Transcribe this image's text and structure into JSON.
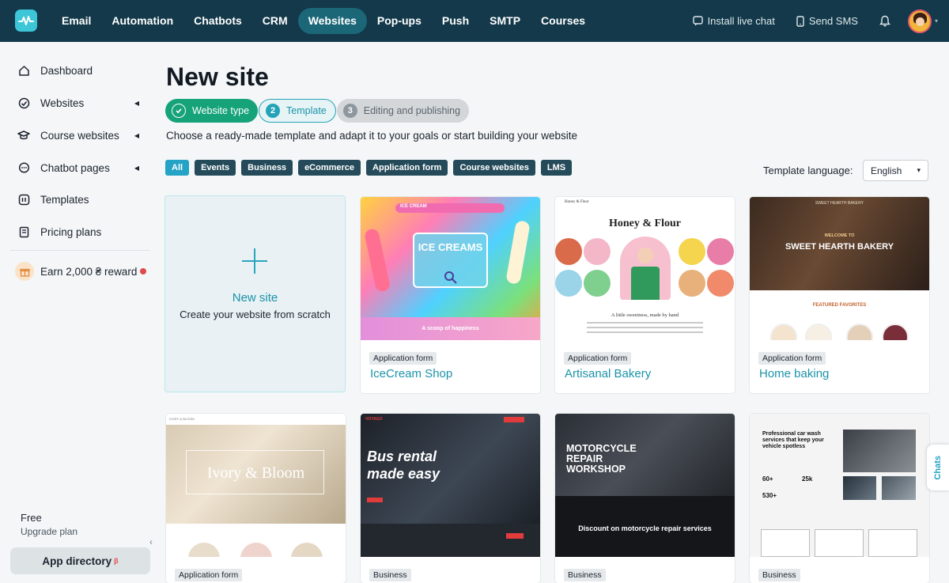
{
  "topbar": {
    "nav": [
      "Email",
      "Automation",
      "Chatbots",
      "CRM",
      "Websites",
      "Pop-ups",
      "Push",
      "SMTP",
      "Courses"
    ],
    "active_nav": "Websites",
    "install_live_chat": "Install live chat",
    "send_sms": "Send SMS",
    "accent": "#13394a"
  },
  "sidebar": {
    "items": [
      {
        "label": "Dashboard",
        "icon": "home-icon"
      },
      {
        "label": "Websites",
        "icon": "globe-icon"
      },
      {
        "label": "Course websites",
        "icon": "graduation-cap-icon"
      },
      {
        "label": "Chatbot pages",
        "icon": "chat-icon"
      },
      {
        "label": "Templates",
        "icon": "template-icon"
      },
      {
        "label": "Pricing plans",
        "icon": "pricing-icon"
      }
    ],
    "earn": "Earn 2,000 ₴ reward",
    "plan": "Free",
    "upgrade": "Upgrade plan",
    "app_directory": "App directory",
    "app_directory_badge": "β"
  },
  "main": {
    "title": "New site",
    "steps": [
      {
        "num": "",
        "label": "Website type"
      },
      {
        "num": "2",
        "label": "Template"
      },
      {
        "num": "3",
        "label": "Editing and publishing"
      }
    ],
    "subtitle": "Choose a ready-made template and adapt it to your goals or start building your website",
    "filters": [
      "All",
      "Events",
      "Business",
      "eCommerce",
      "Application form",
      "Course websites",
      "LMS"
    ],
    "active_filter": "All",
    "language_label": "Template language:",
    "language_value": "English",
    "new_site": {
      "title": "New site",
      "subtitle": "Create your website from scratch"
    },
    "cards": [
      {
        "tag": "Application form",
        "name": "IceCream Shop",
        "thumb": {
          "headline": "ICE CREAMS",
          "brand": "ICE CREAM",
          "caption": "A scoop of happiness"
        }
      },
      {
        "tag": "Application form",
        "name": "Artisanal Bakery",
        "thumb": {
          "brand": "Honey & Flour",
          "headline": "Honey & Flour",
          "caption": "A little sweetness, made by hand"
        }
      },
      {
        "tag": "Application form",
        "name": "Home baking",
        "thumb": {
          "brand": "SWEET HEARTH BAKERY",
          "kicker": "WELCOME TO",
          "headline": "SWEET HEARTH BAKERY",
          "section": "FEATURED FAVORITES"
        }
      },
      {
        "tag": "Application form",
        "name": "",
        "thumb": {
          "brand": "IVORY & BLOOM",
          "headline": "Ivory & Bloom"
        }
      },
      {
        "tag": "Business",
        "name": "",
        "thumb": {
          "brand": "VOYAGO",
          "headline1": "Bus rental",
          "headline2": "made easy"
        }
      },
      {
        "tag": "Business",
        "name": "",
        "thumb": {
          "headline": "MOTORCYCLE REPAIR WORKSHOP",
          "sub": "Discount on motorcycle repair services"
        }
      },
      {
        "tag": "Business",
        "name": "",
        "thumb": {
          "headline": "Professional car wash services that keep your vehicle spotless",
          "stat1": "60+",
          "stat2": "25k",
          "stat3": "530+"
        }
      }
    ]
  },
  "chats_tab": "Chats"
}
